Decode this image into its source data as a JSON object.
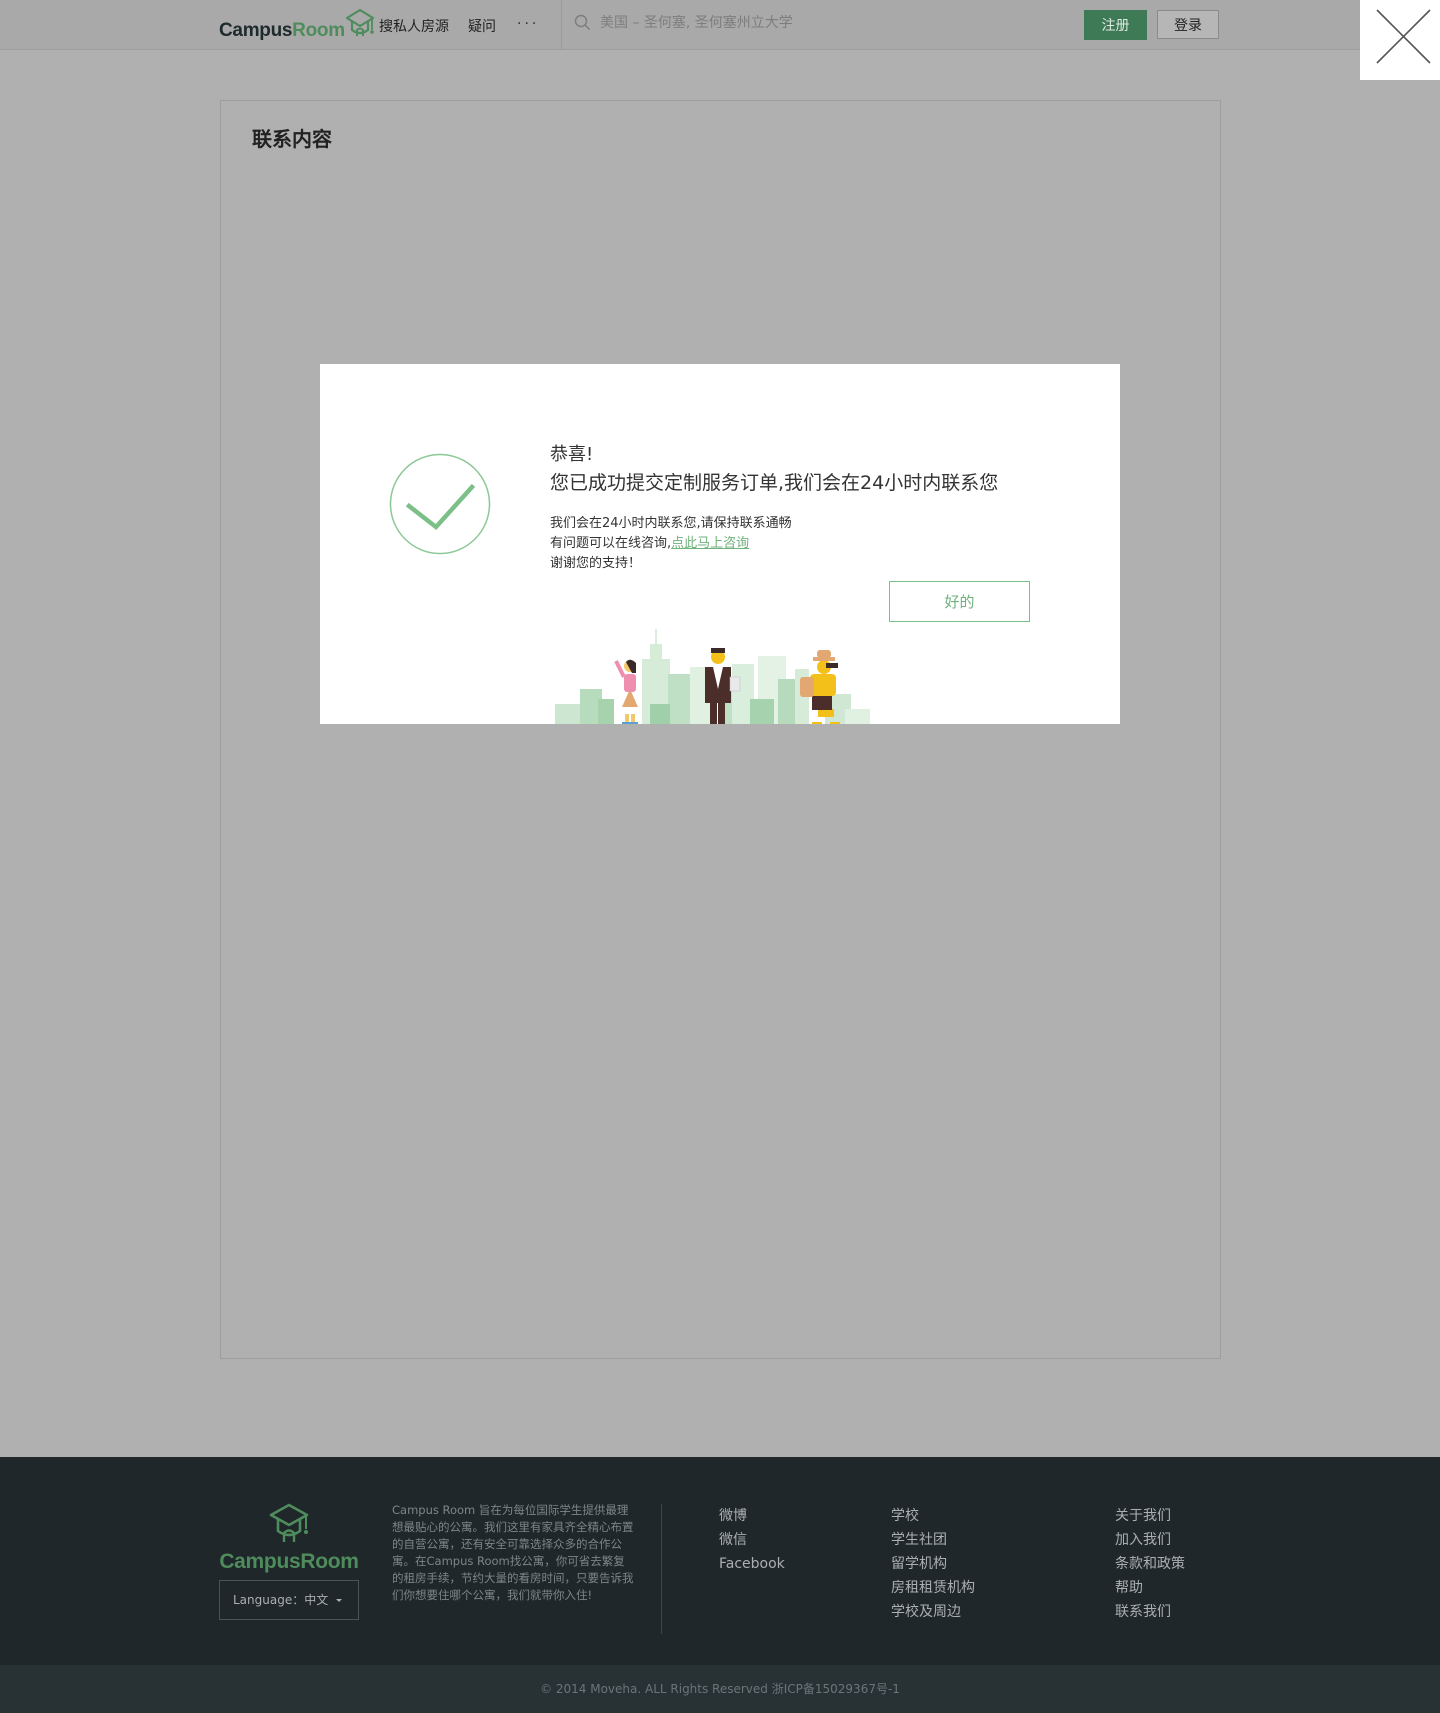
{
  "header": {
    "logo_campus": "Campus",
    "logo_room": "Room",
    "nav": {
      "search_rooms": "搜私人房源",
      "faq": "疑问",
      "more": "···"
    },
    "search_placeholder": "美国 – 圣何塞, 圣何塞州立大学",
    "register": "注册",
    "login": "登录"
  },
  "card": {
    "title": "联系内容"
  },
  "modal": {
    "congrats": "恭喜!",
    "headline": "您已成功提交定制服务订单,我们会在24小时内联系您",
    "line1": "我们会在24小时内联系您,请保持联系通畅",
    "line2_prefix": "有问题可以在线咨询,",
    "line2_link": "点此马上咨询",
    "line3": "谢谢您的支持！",
    "ok_button": "好的"
  },
  "footer": {
    "logo_text": "CampusRoom",
    "language_label": "Language：中文",
    "about": "Campus Room 旨在为每位国际学生提供最理想最贴心的公寓。我们这里有家具齐全精心布置的自营公寓，还有安全可靠选择众多的合作公寓。在Campus Room找公寓，你可省去繁复的租房手续，节约大量的看房时间，只要告诉我们你想要住哪个公寓，我们就带你入住!",
    "social": [
      "微博",
      "微信",
      "Facebook"
    ],
    "schools": [
      "学校",
      "学生社团",
      "留学机构",
      "房租租赁机构",
      "学校及周边"
    ],
    "company": [
      "关于我们",
      "加入我们",
      "条款和政策",
      "帮助",
      "联系我们"
    ],
    "copyright": "© 2014 Moveha. ALL Rights Reserved   浙ICP备15029367号-1"
  },
  "colors": {
    "brand_green": "#4f8c5c",
    "register_button": "#3d7a55",
    "accent_light_green": "#6fb27c",
    "overlay_gray": "#b0b0b0",
    "footer_bg": "#1f272a"
  },
  "icons": [
    "logo-graduation-cap-icon",
    "search-icon",
    "close-icon",
    "checkmark-icon",
    "caret-down-icon",
    "city-people-illustration"
  ]
}
